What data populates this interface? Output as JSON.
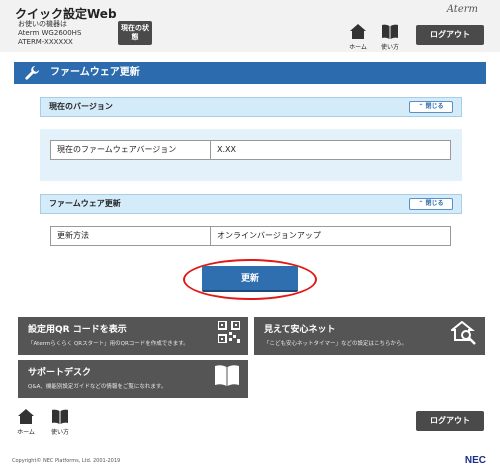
{
  "header": {
    "app_title": "クイック設定Web",
    "device_label": "お使いの機器は",
    "device_model": "Aterm WG2600HS",
    "device_id": "ATERM-XXXXXX",
    "status_button": "現在の状態",
    "brand": "Aterm",
    "home_label": "ホーム",
    "howto_label": "使い方",
    "logout_label": "ログアウト"
  },
  "page": {
    "title": "ファームウェア更新"
  },
  "current_version": {
    "section_title": "現在のバージョン",
    "close_label": "閉じる",
    "field_label": "現在のファームウェアバージョン",
    "field_value": "X.XX"
  },
  "firmware_update": {
    "section_title": "ファームウェア更新",
    "close_label": "閉じる",
    "field_label": "更新方法",
    "field_value": "オンラインバージョンアップ",
    "update_button": "更新"
  },
  "tiles": [
    {
      "title": "設定用QR コードを表示",
      "desc": "「Atermらくらく QRスタート」用のQRコードを作成できます。",
      "icon": "qr-code-icon"
    },
    {
      "title": "見えて安心ネット",
      "desc": "「こども安心ネットタイマー」などの設定はこちらから。",
      "icon": "home-search-icon"
    },
    {
      "title": "サポートデスク",
      "desc": "Q&A、機能別設定ガイドなどの情報をご覧になれます。",
      "icon": "book-icon"
    }
  ],
  "footer": {
    "home_label": "ホーム",
    "howto_label": "使い方",
    "logout_label": "ログアウト",
    "copyright": "Copyright© NEC Platforms, Ltd. 2001-2019",
    "logo": "NEC"
  },
  "colors": {
    "primary_blue": "#2c6cae",
    "section_bg": "#d4ebf9",
    "tile_bg": "#555555",
    "highlight": "#e01818"
  }
}
